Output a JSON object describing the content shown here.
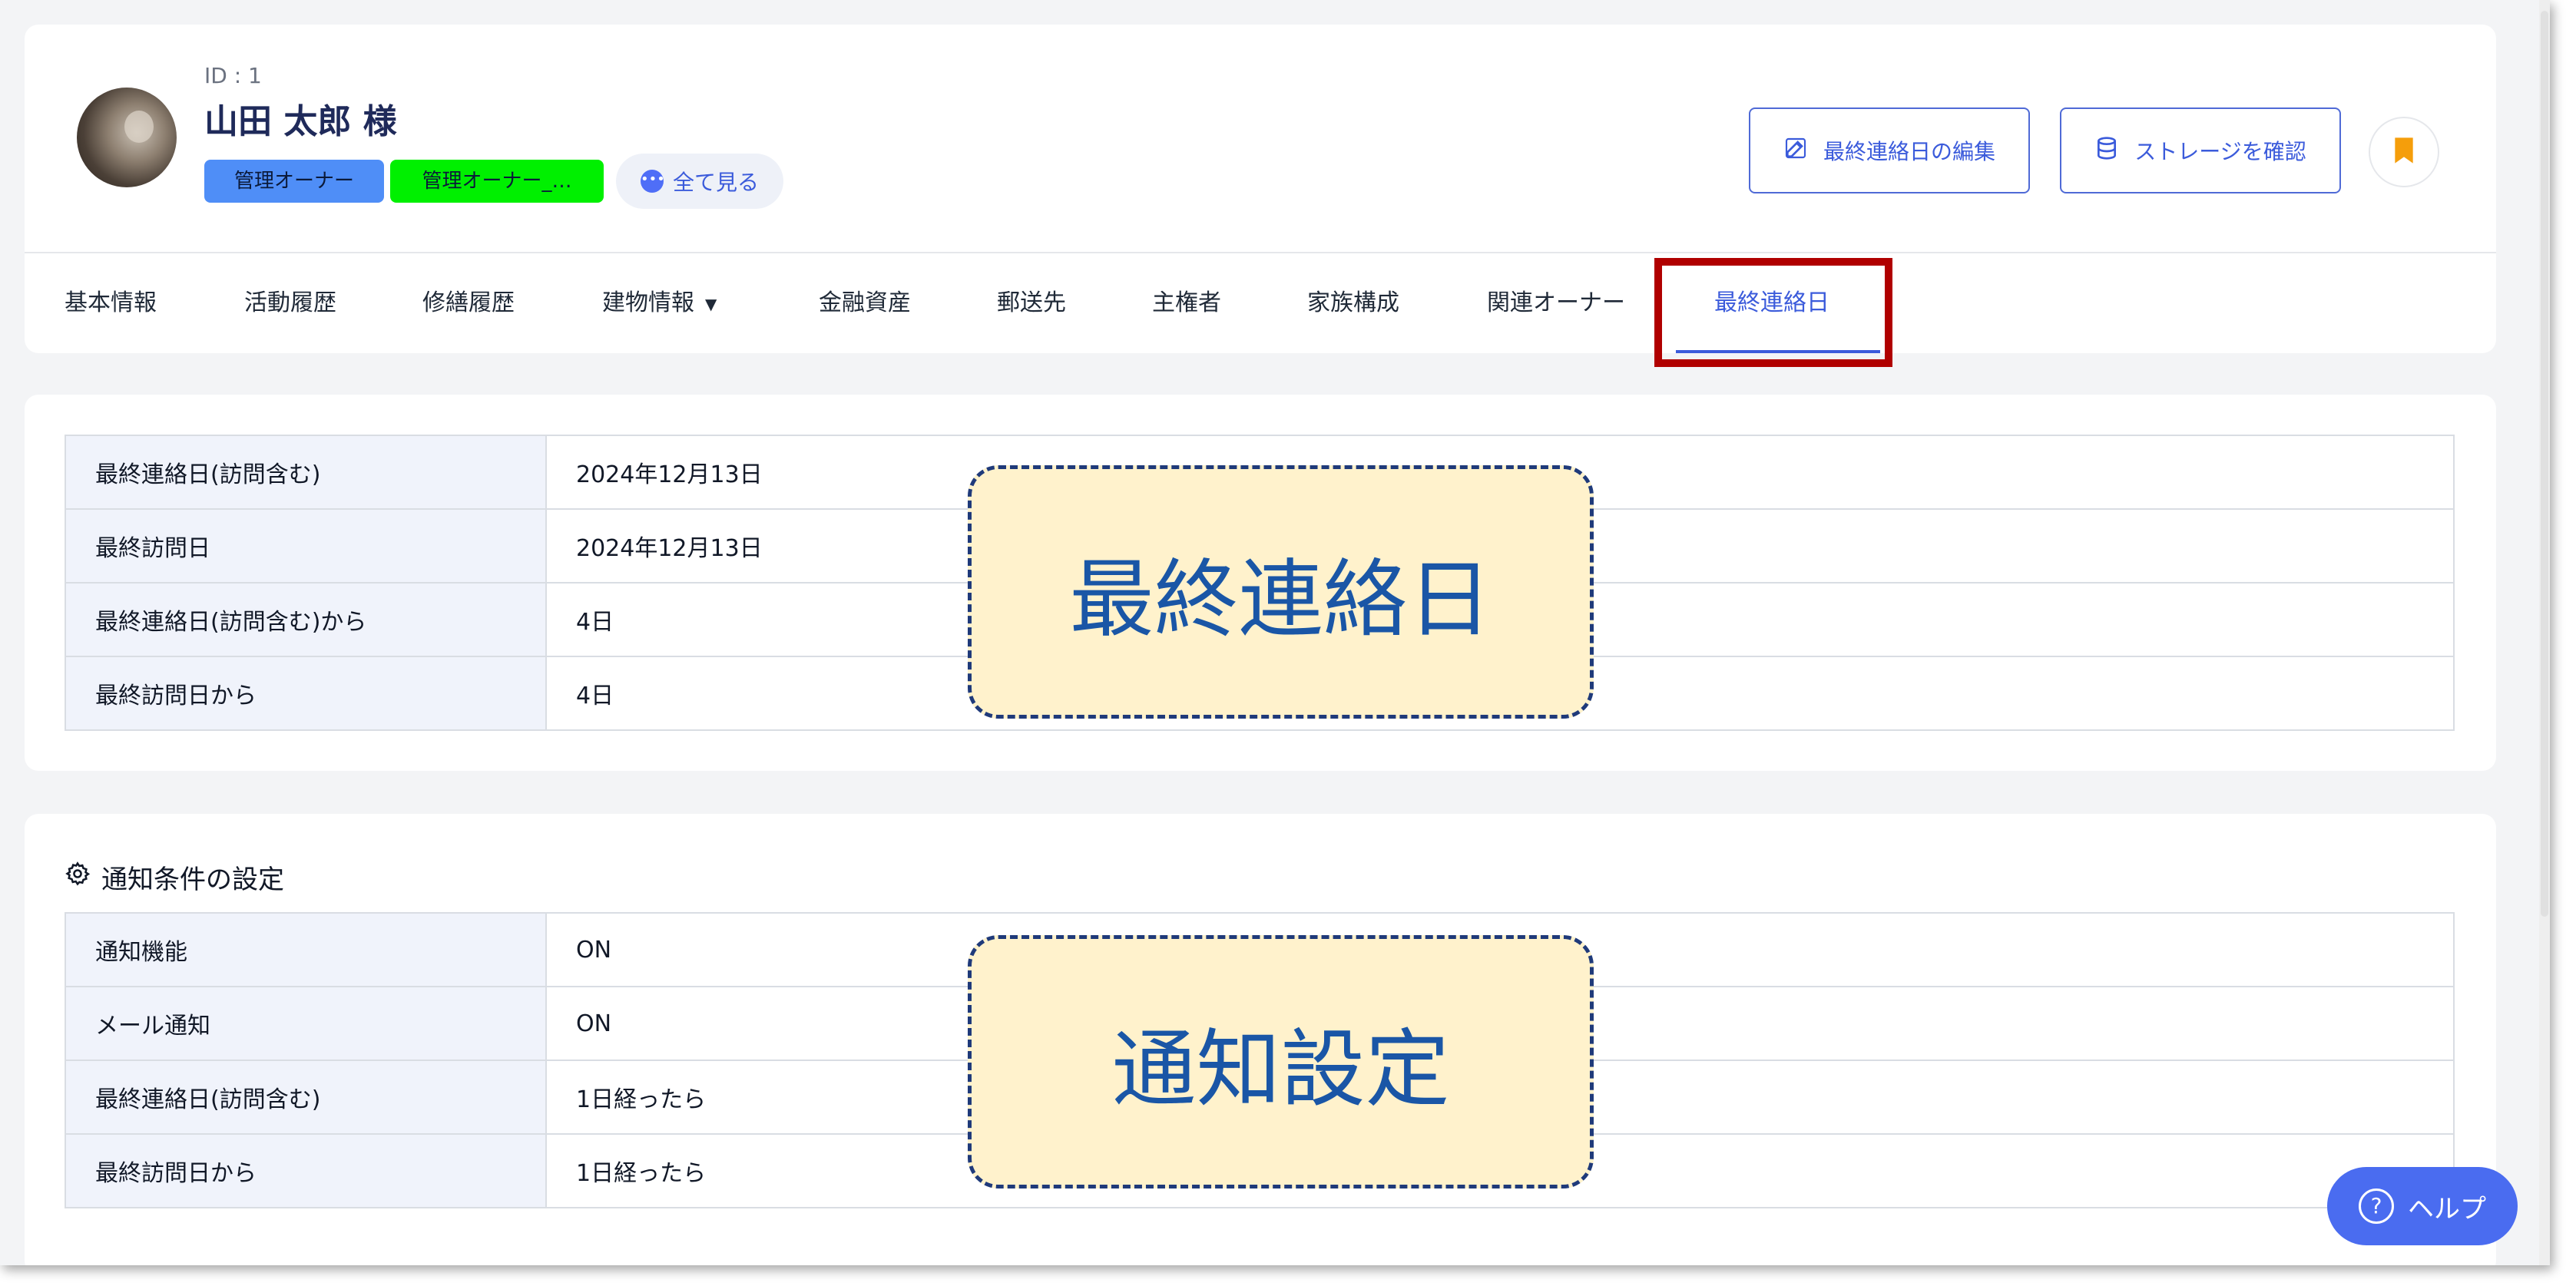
{
  "owner": {
    "id_label": "ID : 1",
    "name": "山田 太郎 様",
    "tags": [
      "管理オーナー",
      "管理オーナー_…"
    ],
    "see_all_label": "全て見る"
  },
  "header_actions": {
    "edit_last_contact_label": "最終連絡日の編集",
    "check_storage_label": "ストレージを確認"
  },
  "tabs": [
    {
      "label": "基本情報"
    },
    {
      "label": "活動履歴"
    },
    {
      "label": "修繕履歴"
    },
    {
      "label": "建物情報"
    },
    {
      "label": "金融資産"
    },
    {
      "label": "郵送先"
    },
    {
      "label": "主権者"
    },
    {
      "label": "家族構成"
    },
    {
      "label": "関連オーナー"
    },
    {
      "label": "最終連絡日",
      "active": true
    }
  ],
  "last_contact_table": [
    {
      "key": "最終連絡日(訪問含む)",
      "value": "2024年12月13日"
    },
    {
      "key": "最終訪問日",
      "value": "2024年12月13日"
    },
    {
      "key": "最終連絡日(訪問含む)から",
      "value": "4日"
    },
    {
      "key": "最終訪問日から",
      "value": "4日"
    }
  ],
  "notification": {
    "title": "通知条件の設定",
    "rows": [
      {
        "key": "通知機能",
        "value": "ON"
      },
      {
        "key": "メール通知",
        "value": "ON"
      },
      {
        "key": "最終連絡日(訪問含む)",
        "value": "1日経ったら"
      },
      {
        "key": "最終訪問日から",
        "value": "1日経ったら"
      }
    ]
  },
  "callouts": {
    "last_contact": "最終連絡日",
    "notification_settings": "通知設定"
  },
  "help_label": "ヘルプ",
  "colors": {
    "accent": "#3b5bdb",
    "tag_blue": "#4f8ef7",
    "tag_green": "#00f000",
    "highlight_red": "#b00000",
    "callout_fill": "#fff2cc",
    "callout_text": "#1a56a6",
    "bookmark_orange": "#f59e0b"
  },
  "icons": {
    "edit": "edit-icon",
    "storage": "database-icon",
    "bookmark": "bookmark-icon",
    "settings": "gear-icon",
    "help": "help-icon"
  }
}
